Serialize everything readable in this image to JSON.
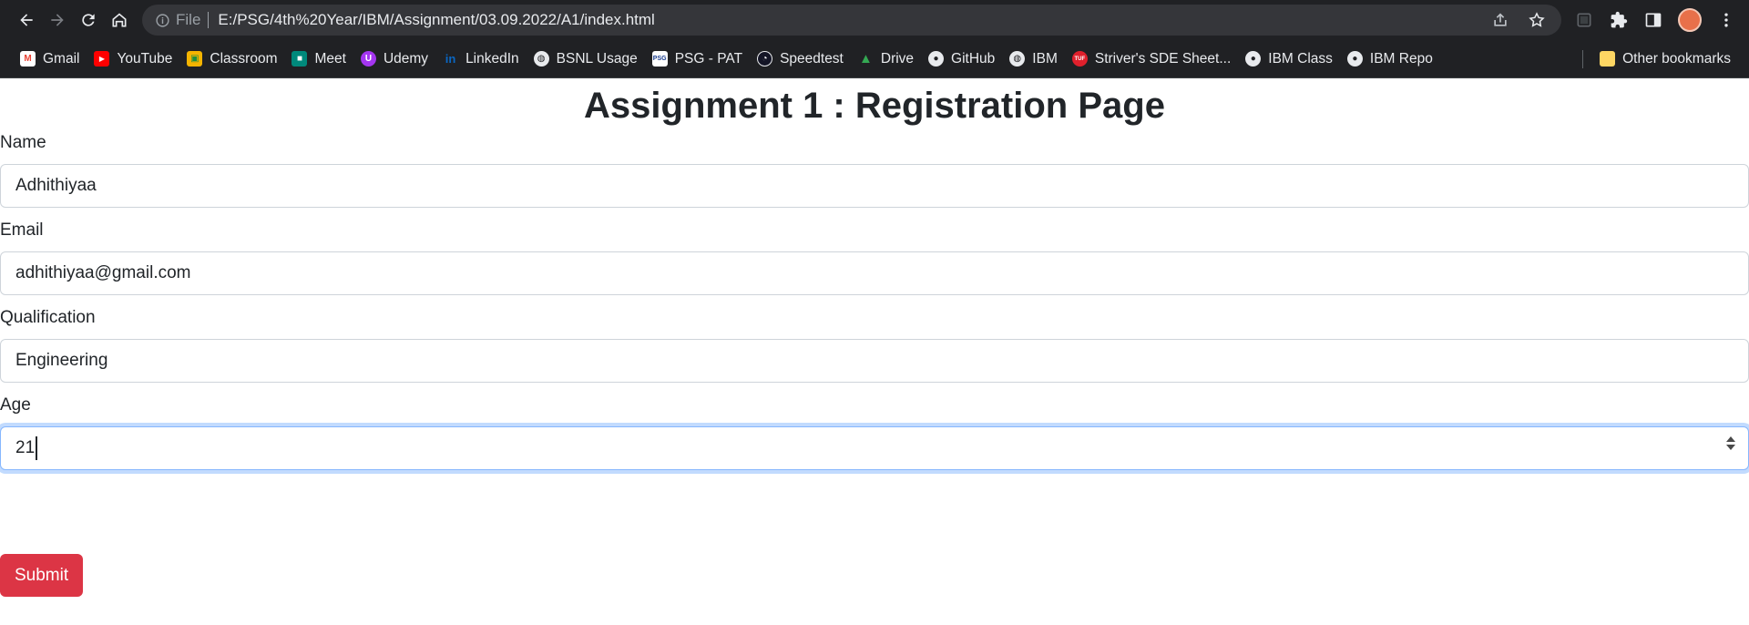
{
  "browser": {
    "url_scheme_label": "File",
    "url": "E:/PSG/4th%20Year/IBM/Assignment/03.09.2022/A1/index.html"
  },
  "bookmarks": {
    "items": [
      {
        "label": "Gmail",
        "icon": "gmail-icon",
        "color": "#ea4335"
      },
      {
        "label": "YouTube",
        "icon": "youtube-icon",
        "color": "#ff0000"
      },
      {
        "label": "Classroom",
        "icon": "classroom-icon",
        "color": "#f4b400"
      },
      {
        "label": "Meet",
        "icon": "meet-icon",
        "color": "#00897b"
      },
      {
        "label": "Udemy",
        "icon": "udemy-icon",
        "color": "#a435f0"
      },
      {
        "label": "LinkedIn",
        "icon": "linkedin-icon",
        "color": "#0a66c2"
      },
      {
        "label": "BSNL Usage",
        "icon": "globe-icon",
        "color": "#e8eaed"
      },
      {
        "label": "PSG - PAT",
        "icon": "psg-icon",
        "color": "#ffffff"
      },
      {
        "label": "Speedtest",
        "icon": "speedtest-icon",
        "color": "#141526"
      },
      {
        "label": "Drive",
        "icon": "drive-icon",
        "color": "#34a853"
      },
      {
        "label": "GitHub",
        "icon": "github-icon",
        "color": "#e8eaed"
      },
      {
        "label": "IBM",
        "icon": "globe-icon",
        "color": "#e8eaed"
      },
      {
        "label": "Striver's SDE Sheet...",
        "icon": "tuf-icon",
        "color": "#e0202c"
      },
      {
        "label": "IBM Class",
        "icon": "github-icon",
        "color": "#e8eaed"
      },
      {
        "label": "IBM Repo",
        "icon": "github-icon",
        "color": "#e8eaed"
      }
    ],
    "other_label": "Other bookmarks"
  },
  "page": {
    "title": "Assignment 1 : Registration Page",
    "fields": [
      {
        "label": "Name",
        "value": "Adhithiyaa"
      },
      {
        "label": "Email",
        "value": "adhithiyaa@gmail.com"
      },
      {
        "label": "Qualification",
        "value": "Engineering"
      },
      {
        "label": "Age",
        "value": "21"
      }
    ],
    "submit_label": "Submit",
    "submit_color": "#dc3545"
  }
}
